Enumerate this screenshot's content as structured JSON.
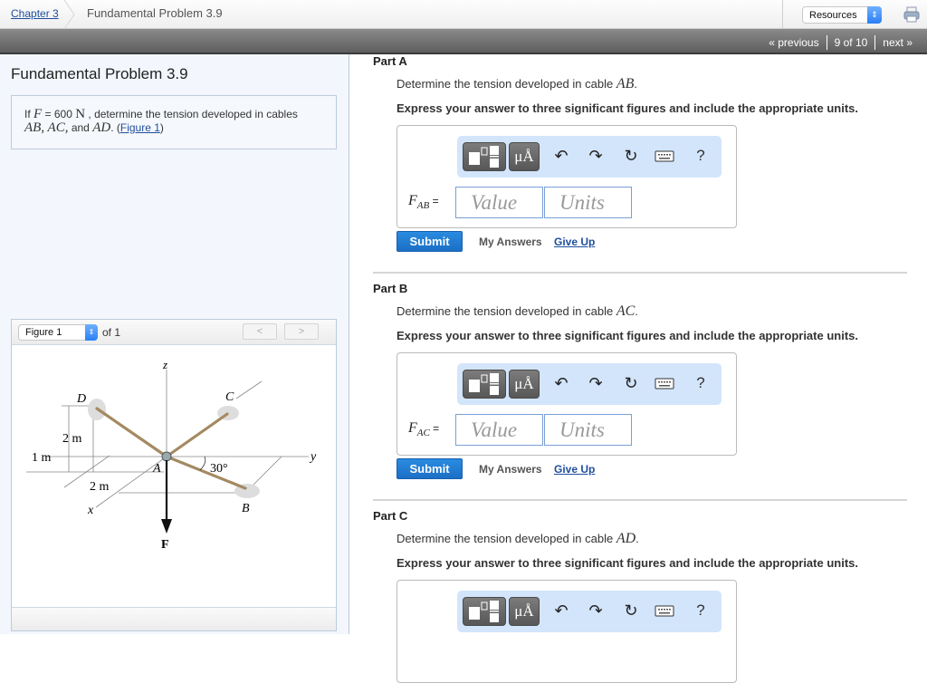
{
  "breadcrumb": {
    "chapter_link": "Chapter 3",
    "current": "Fundamental Problem 3.9"
  },
  "resources": {
    "label": "Resources",
    "stepper": "⇕"
  },
  "nav": {
    "previous": "« previous",
    "position": "9 of 10",
    "next": "next »"
  },
  "problem": {
    "title": "Fundamental Problem 3.9",
    "text_if": "If",
    "var_F": "F",
    "eq": " = 600 ",
    "unit_N": "N",
    "text_rest": " , determine the tension developed in cables",
    "cables": "AB, AC,",
    "text_and": " and ",
    "cable_ad": "AD",
    "period": ". (",
    "figure_link": "Figure 1",
    "close": ")"
  },
  "figure": {
    "selected": "Figure 1",
    "of_label": "of 1",
    "prev": "<",
    "next": ">",
    "labels": {
      "z": "z",
      "y": "y",
      "x": "x",
      "A": "A",
      "B": "B",
      "C": "C",
      "D": "D",
      "F": "F",
      "angle": "30°",
      "dim_2m_vert": "2 m",
      "dim_1m": "1 m",
      "dim_2m_horiz": "2 m"
    }
  },
  "parts": [
    {
      "title": "Part A",
      "question": "Determine the tension developed in cable",
      "cable": "AB",
      "instruction": "Express your answer to three significant figures and include the appropriate units.",
      "label_var": "F",
      "label_sub": "AB",
      "label_eq": " =",
      "value_placeholder": "Value",
      "units_placeholder": "Units",
      "submit": "Submit",
      "my_answers": "My Answers",
      "give_up": "Give Up"
    },
    {
      "title": "Part B",
      "question": "Determine the tension developed in cable",
      "cable": "AC",
      "instruction": "Express your answer to three significant figures and include the appropriate units.",
      "label_var": "F",
      "label_sub": "AC",
      "label_eq": " =",
      "value_placeholder": "Value",
      "units_placeholder": "Units",
      "submit": "Submit",
      "my_answers": "My Answers",
      "give_up": "Give Up"
    },
    {
      "title": "Part C",
      "question": "Determine the tension developed in cable",
      "cable": "AD",
      "instruction": "Express your answer to three significant figures and include the appropriate units."
    }
  ],
  "toolbar": {
    "units_glyph": "μÅ",
    "undo": "↶",
    "redo": "↷",
    "reset": "↻",
    "help": "?"
  },
  "colors": {
    "link": "#1f4e9e",
    "submit": "#1b6fc5",
    "toolbar_bg": "#d3e5fb",
    "cable": "#a48a62"
  }
}
